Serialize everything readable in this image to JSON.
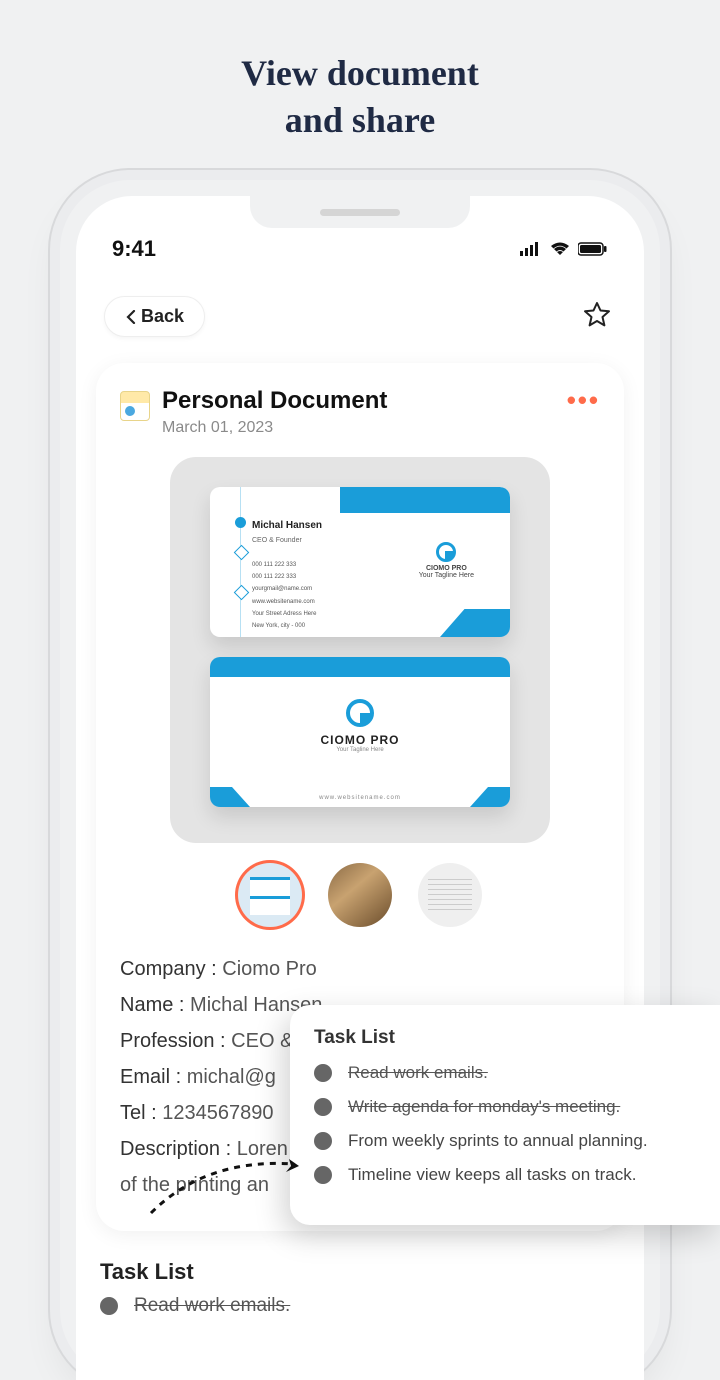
{
  "page_title_line1": "View document",
  "page_title_line2": "and share",
  "statusbar": {
    "time": "9:41"
  },
  "topbar": {
    "back_label": "Back"
  },
  "card": {
    "title": "Personal Document",
    "date": "March 01, 2023"
  },
  "business_card": {
    "name": "Michal Hansen",
    "role": "CEO & Founder",
    "phone1": "000 111 222 333",
    "phone2": "000 111 222 333",
    "email": "yourgmail@name.com",
    "website": "www.websitename.com",
    "address1": "Your Street Adress Here",
    "address2": "New York, city - 000",
    "brand": "CIOMO PRO",
    "tagline": "Your Tagline Here",
    "web_footer": "www.websitename.com"
  },
  "details": {
    "company_label": "Company :",
    "company_value": "Ciomo Pro",
    "name_label": "Name :",
    "name_value": "Michal Hansen",
    "profession_label": "Profession :",
    "profession_value": "CEO &",
    "email_label": "Email :",
    "email_value": "michal@g",
    "tel_label": "Tel :",
    "tel_value": "1234567890",
    "description_label": "Description :",
    "description_value": "Loren",
    "description_cont": "of the printing an"
  },
  "tasklist": {
    "title": "Task List",
    "items": [
      {
        "text": "Read work emails.",
        "done": true
      },
      {
        "text": "Write agenda for monday's meeting.",
        "done": true
      },
      {
        "text": "From weekly sprints to annual planning.",
        "done": false
      },
      {
        "text": "Timeline view keeps all tasks on track.",
        "done": false
      }
    ]
  },
  "tasklist_below": {
    "title": "Task List",
    "first_item": "Read work emails."
  }
}
